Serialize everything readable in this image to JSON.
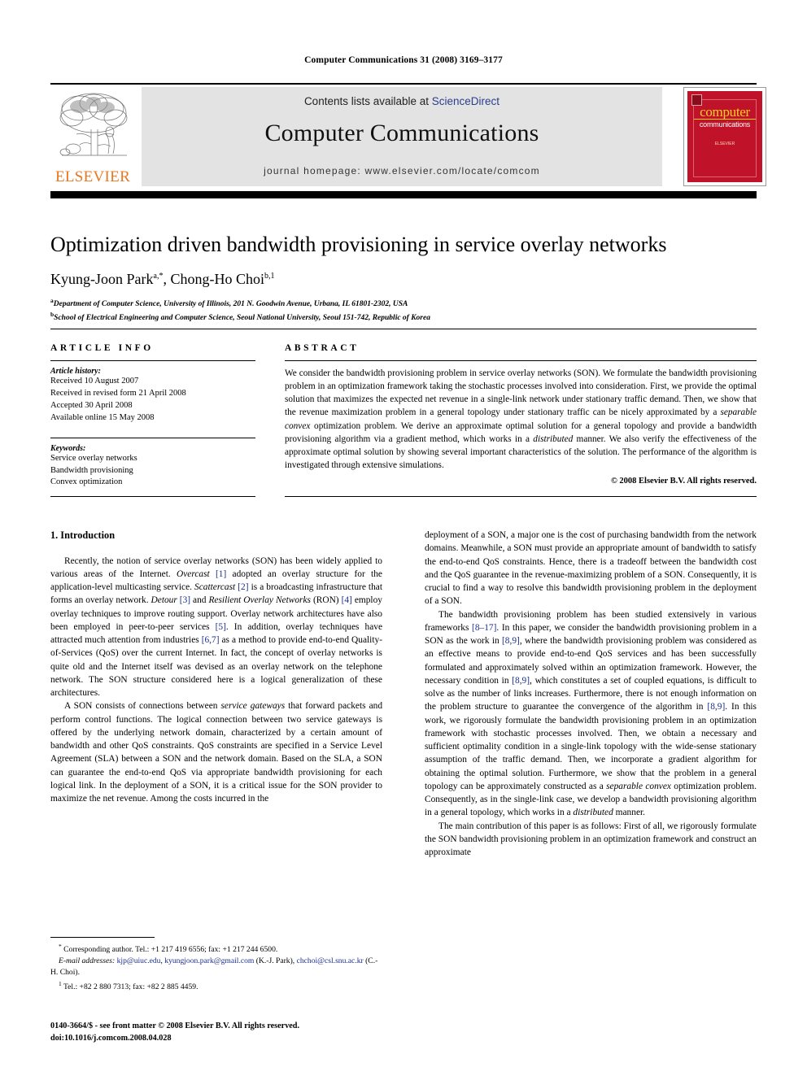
{
  "running_head": "Computer Communications 31 (2008) 3169–3177",
  "masthead": {
    "contents_prefix": "Contents lists available at ",
    "sciencedirect": "ScienceDirect",
    "journal_title": "Computer Communications",
    "homepage": "journal homepage: www.elsevier.com/locate/comcom",
    "publisher_wordmark": "ELSEVIER",
    "cover": {
      "line1": "computer",
      "line2": "communications",
      "badge": "ELSEVIER"
    },
    "colors": {
      "banner_bg": "#e3e3e3",
      "sciencedirect_blue": "#2a3e8c",
      "elsevier_orange": "#e87722",
      "cover_red": "#c0132a",
      "cover_yellow": "#f5d020"
    }
  },
  "article": {
    "title": "Optimization driven bandwidth provisioning in service overlay networks",
    "authors": "Kyung-Joon Park",
    "author_sup_1": "a,*",
    "authors_2": ", Chong-Ho Choi",
    "author_sup_2": "b,1",
    "affiliation_a_sup": "a",
    "affiliation_a": "Department of Computer Science, University of Illinois, 201 N. Goodwin Avenue, Urbana, IL 61801-2302, USA",
    "affiliation_b_sup": "b",
    "affiliation_b": "School of Electrical Engineering and Computer Science, Seoul National University, Seoul 151-742, Republic of Korea"
  },
  "info": {
    "heading": "ARTICLE INFO",
    "history_label": "Article history:",
    "history": [
      "Received 10 August 2007",
      "Received in revised form 21 April 2008",
      "Accepted 30 April 2008",
      "Available online 15 May 2008"
    ],
    "keywords_label": "Keywords:",
    "keywords": [
      "Service overlay networks",
      "Bandwidth provisioning",
      "Convex optimization"
    ]
  },
  "abstract": {
    "heading": "ABSTRACT",
    "p1": "We consider the bandwidth provisioning problem in service overlay networks (SON). We formulate the bandwidth provisioning problem in an optimization framework taking the stochastic processes involved into consideration. First, we provide the optimal solution that maximizes the expected net revenue in a single-link network under stationary traffic demand. Then, we show that the revenue maximization problem in a general topology under stationary traffic can be nicely approximated by a ",
    "em1": "separable convex",
    "p2": " optimization problem. We derive an approximate optimal solution for a general topology and provide a bandwidth provisioning algorithm via a gradient method, which works in a ",
    "em2": "distributed",
    "p3": " manner. We also verify the effectiveness of the approximate optimal solution by showing several important characteristics of the solution. The performance of the algorithm is investigated through extensive simulations.",
    "copyright": "© 2008 Elsevier B.V. All rights reserved."
  },
  "body": {
    "section_title": "1. Introduction",
    "left": {
      "p1_a": "Recently, the notion of service overlay networks (SON) has been widely applied to various areas of the Internet. ",
      "p1_em1": "Overcast",
      "p1_r1": "[1]",
      "p1_b": " adopted an overlay structure for the application-level multicasting service. ",
      "p1_em2": "Scattercast",
      "p1_r2": "[2]",
      "p1_c": " is a broadcasting infrastructure that forms an overlay network. ",
      "p1_em3": "Detour",
      "p1_r3": "[3]",
      "p1_d": " and ",
      "p1_em4": "Resilient Overlay Networks",
      "p1_e": " (RON) ",
      "p1_r4": "[4]",
      "p1_f": " employ overlay techniques to improve routing support. Overlay network architectures have also been employed in peer-to-peer services ",
      "p1_r5": "[5]",
      "p1_g": ". In addition, overlay techniques have attracted much attention from industries ",
      "p1_r6": "[6,7]",
      "p1_h": " as a method to provide end-to-end Quality-of-Services (QoS) over the current Internet. In fact, the concept of overlay networks is quite old and the Internet itself was devised as an overlay network on the telephone network. The SON structure considered here is a logical generalization of these architectures.",
      "p2_a": "A SON consists of connections between ",
      "p2_em1": "service gateways",
      "p2_b": " that forward packets and perform control functions. The logical connection between two service gateways is offered by the underlying network domain, characterized by a certain amount of bandwidth and other QoS constraints. QoS constraints are specified in a Service Level Agreement (SLA) between a SON and the network domain. Based on the SLA, a SON can guarantee the end-to-end QoS via appropriate bandwidth provisioning for each logical link. In the deployment of a SON, it is a critical issue for the SON provider to maximize the net revenue. Among the costs incurred in the"
    },
    "right": {
      "p1": "deployment of a SON, a major one is the cost of purchasing bandwidth from the network domains. Meanwhile, a SON must provide an appropriate amount of bandwidth to satisfy the end-to-end QoS constraints. Hence, there is a tradeoff between the bandwidth cost and the QoS guarantee in the revenue-maximizing problem of a SON. Consequently, it is crucial to find a way to resolve this bandwidth provisioning problem in the deployment of a SON.",
      "p2_a": "The bandwidth provisioning problem has been studied extensively in various frameworks ",
      "p2_r1": "[8–17]",
      "p2_b": ". In this paper, we consider the bandwidth provisioning problem in a SON as the work in ",
      "p2_r2": "[8,9]",
      "p2_c": ", where the bandwidth provisioning problem was considered as an effective means to provide end-to-end QoS services and has been successfully formulated and approximately solved within an optimization framework. However, the necessary condition in ",
      "p2_r3": "[8,9]",
      "p2_d": ", which constitutes a set of coupled equations, is difficult to solve as the number of links increases. Furthermore, there is not enough information on the problem structure to guarantee the convergence of the algorithm in ",
      "p2_r4": "[8,9]",
      "p2_e": ". In this work, we rigorously formulate the bandwidth provisioning problem in an optimization framework with stochastic processes involved. Then, we obtain a necessary and sufficient optimality condition in a single-link topology with the wide-sense stationary assumption of the traffic demand. Then, we incorporate a gradient algorithm for obtaining the optimal solution. Furthermore, we show that the problem in a general topology can be approximately constructed as a ",
      "p2_em1": "separable convex",
      "p2_f": " optimization problem. Consequently, as in the single-link case, we develop a bandwidth provisioning algorithm in a general topology, which works in a ",
      "p2_em2": "distributed",
      "p2_g": " manner.",
      "p3": "The main contribution of this paper is as follows: First of all, we rigorously formulate the SON bandwidth provisioning problem in an optimization framework and construct an approximate"
    }
  },
  "footnotes": {
    "corresponding_sup": "*",
    "corresponding": " Corresponding author. Tel.: +1 217 419 6556; fax: +1 217 244 6500.",
    "email_label": "E-mail addresses:",
    "email1": "kjp@uiuc.edu",
    "email_sep1": ", ",
    "email2": "kyungjoon.park@gmail.com",
    "email_name1": " (K.-J. Park), ",
    "email3": "chchoi@csl.snu.ac.kr",
    "email_name2": " (C.-H. Choi).",
    "tel_sup": "1",
    "tel": " Tel.: +82 2 880 7313; fax: +82 2 885 4459."
  },
  "imprint": {
    "line1": "0140-3664/$ - see front matter © 2008 Elsevier B.V. All rights reserved.",
    "line2": "doi:10.1016/j.comcom.2008.04.028"
  }
}
